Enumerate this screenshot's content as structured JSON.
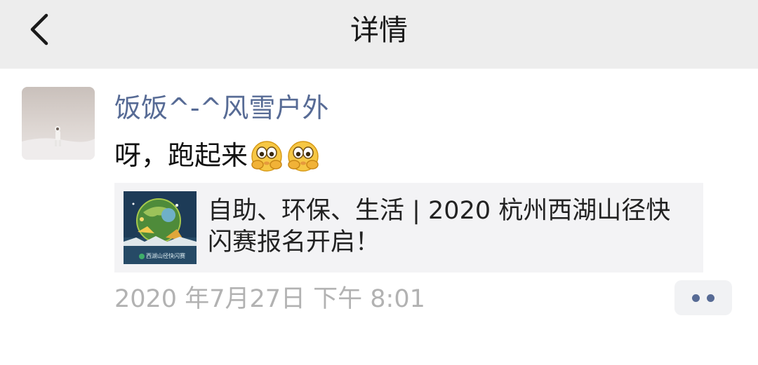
{
  "nav": {
    "title": "详情"
  },
  "post": {
    "author": "饭饭^-^风雪户外",
    "text": "呀，跑起来",
    "emojis": [
      "peeking-emoji",
      "peeking-emoji"
    ],
    "link": {
      "title": "自助、环保、生活 | 2020 杭州西湖山径快闪赛报名开启！",
      "thumb_caption": "西湖山径快闪赛"
    },
    "timestamp": "2020 年7月27日 下午 8:01"
  },
  "colors": {
    "nav_bg": "#ededed",
    "name": "#576b95",
    "card_bg": "#f3f3f5",
    "time": "#b2b2b2"
  }
}
